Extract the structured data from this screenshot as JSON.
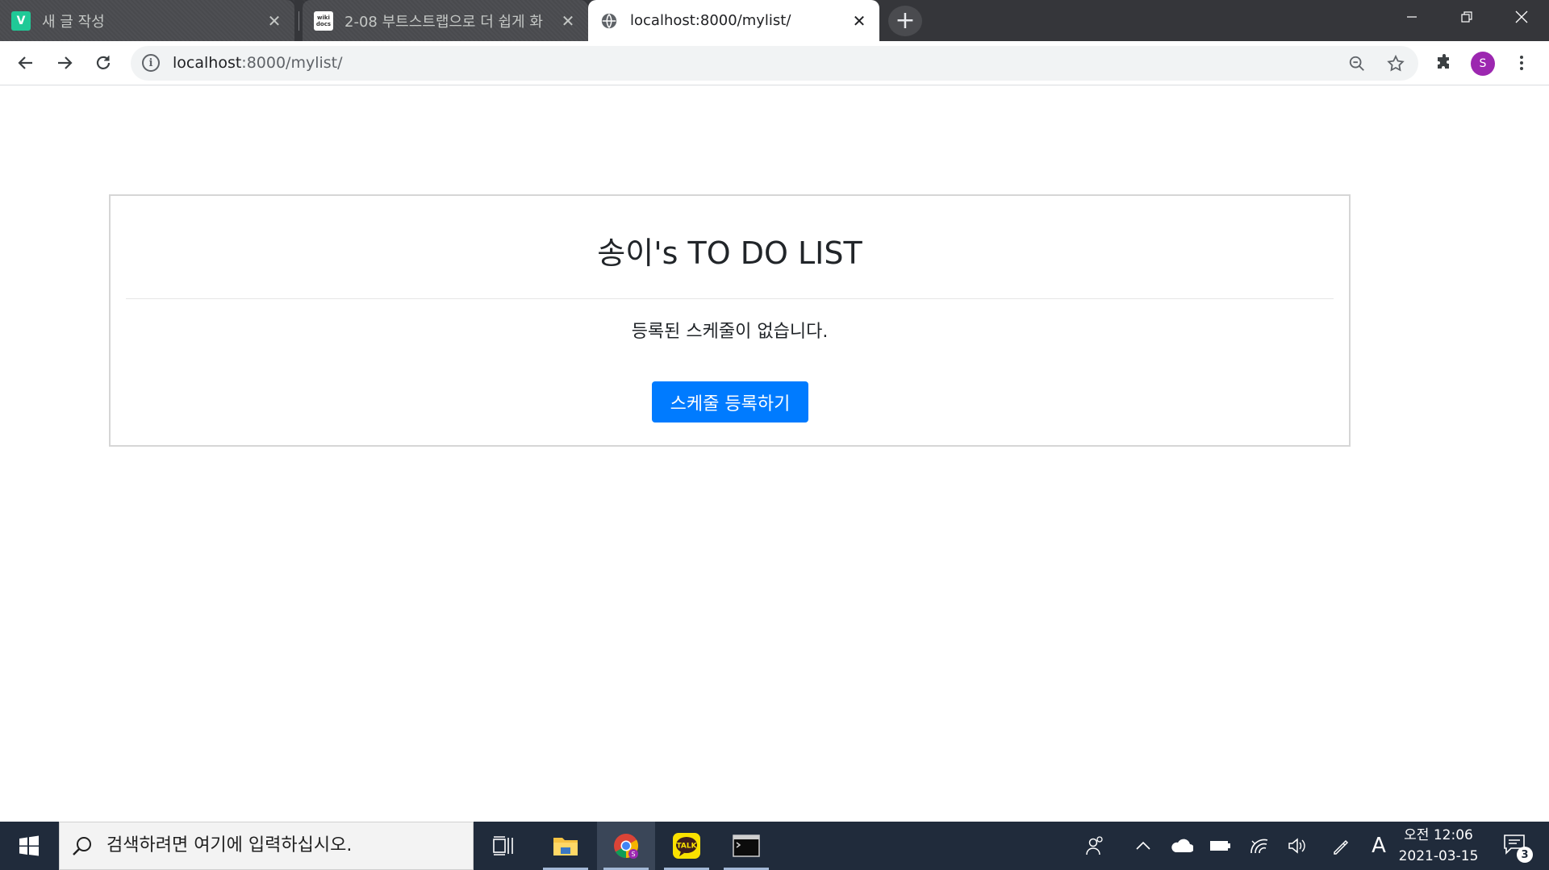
{
  "browser": {
    "tabs": [
      {
        "title": "새 글 작성",
        "favicon": "velog-v-icon"
      },
      {
        "title": "2-08 부트스트랩으로 더 쉽게 화",
        "favicon": "wikidocs-icon"
      },
      {
        "title": "localhost:8000/mylist/",
        "favicon": "globe-icon",
        "active": true
      }
    ],
    "address": {
      "host": "localhost",
      "rest": ":8000/mylist/"
    },
    "profile_initial": "S",
    "favicon_labels": {
      "velog": "V",
      "wikidocs": "wiki docs"
    }
  },
  "page": {
    "title": "송이's TO DO LIST",
    "empty_message": "등록된 스케줄이 없습니다.",
    "add_button": "스케줄 등록하기",
    "accent_color": "#007bff"
  },
  "taskbar": {
    "search_placeholder": "검색하려면 여기에 입력하십시오.",
    "apps": [
      "task-view",
      "file-explorer",
      "chrome",
      "kakaotalk",
      "terminal"
    ],
    "kakao_label": "TALK",
    "ime_indicator": "A",
    "clock_time": "오전 12:06",
    "clock_date": "2021-03-15",
    "notification_count": "3"
  }
}
